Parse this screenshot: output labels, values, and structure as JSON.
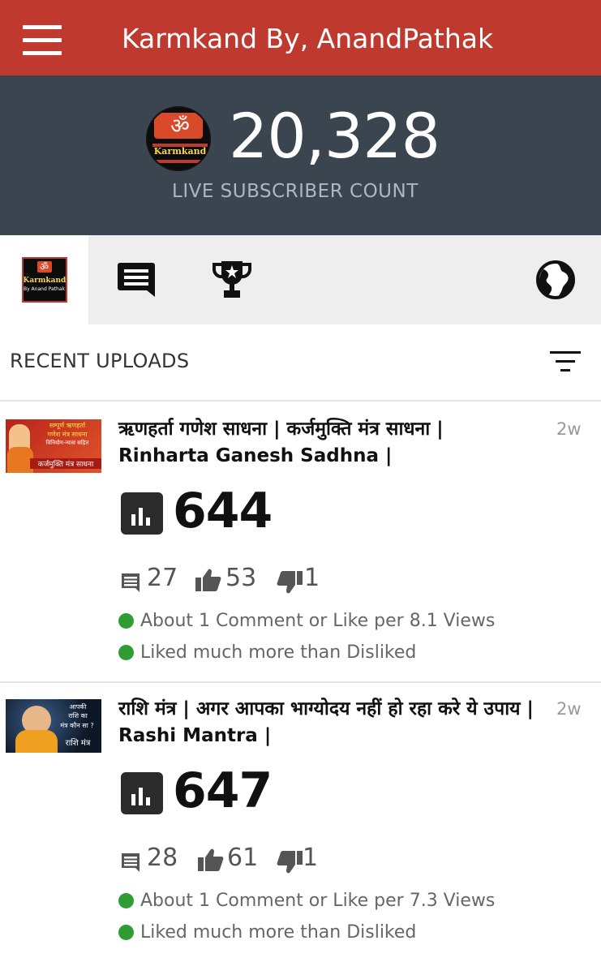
{
  "app": {
    "title": "Karmkand By, AnandPathak"
  },
  "header": {
    "count": "20,328",
    "label": "LIVE SUBSCRIBER COUNT",
    "logo_text": "Karmkand",
    "logo_subtext": "By Anand Pathak",
    "logo_symbol": "ॐ"
  },
  "tabs": [
    {
      "name": "channel-logo-icon"
    },
    {
      "name": "comments-icon"
    },
    {
      "name": "trophy-icon"
    },
    {
      "name": "globe-icon"
    }
  ],
  "section": {
    "title": "RECENT UPLOADS"
  },
  "videos": [
    {
      "title": "ऋणहर्ता गणेश साधना | कर्जमुक्ति मंत्र साधना | Rinharta Ganesh Sadhna |",
      "age": "2w",
      "views": "644",
      "comments": "27",
      "likes": "53",
      "dislikes": "1",
      "note1": "About 1 Comment or Like per 8.1 Views",
      "note2": "Liked much more than Disliked",
      "thumb_line1": "सम्पूर्ण ऋणहर्ता",
      "thumb_line2": "गणेश मंत्र साधना",
      "thumb_line3": "विनियोग-न्यास सहित",
      "thumb_line4": "कर्जमुक्ति मंत्र साधना"
    },
    {
      "title": "राशि मंत्र | अगर आपका भाग्योदय नहीं हो रहा करे ये उपाय | Rashi Mantra |",
      "age": "2w",
      "views": "647",
      "comments": "28",
      "likes": "61",
      "dislikes": "1",
      "note1": "About 1 Comment or Like per 7.3 Views",
      "note2": "Liked much more than Disliked",
      "thumb_line1": "आपकी",
      "thumb_line2": "राशि का",
      "thumb_line3": "मंत्र कौन सा ?",
      "thumb_line4": "राशि मंत्र"
    }
  ],
  "colors": {
    "topbar": "#c0392f",
    "header": "#3a4550",
    "status_green": "#2e9e34"
  }
}
